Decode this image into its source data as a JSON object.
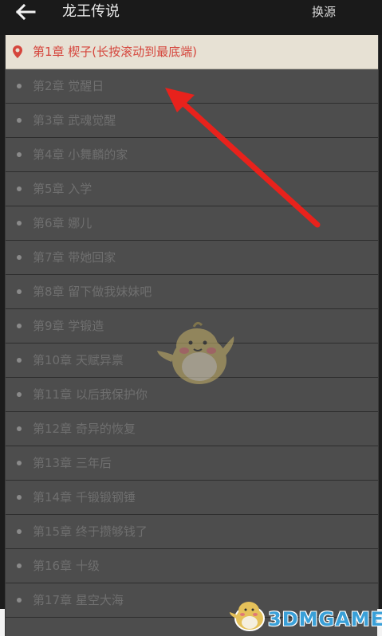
{
  "header": {
    "back_icon": "arrow-left-icon",
    "title": "龙王传说",
    "source_label": "换源"
  },
  "chapters": [
    {
      "label": "第1章 楔子(长按滚动到最底端)",
      "current": true
    },
    {
      "label": "第2章 觉醒日"
    },
    {
      "label": "第3章 武魂觉醒"
    },
    {
      "label": "第4章 小舞麟的家"
    },
    {
      "label": "第5章 入学"
    },
    {
      "label": "第6章 娜儿"
    },
    {
      "label": "第7章 带她回家"
    },
    {
      "label": "第8章 留下做我妹妹吧"
    },
    {
      "label": "第9章 学锻造"
    },
    {
      "label": "第10章 天赋异禀"
    },
    {
      "label": "第11章 以后我保护你"
    },
    {
      "label": "第12章 奇异的恢复"
    },
    {
      "label": "第13章 三年后"
    },
    {
      "label": "第14章 千锻锻钢锤"
    },
    {
      "label": "第15章 终于攒够钱了"
    },
    {
      "label": "第16章 十级"
    },
    {
      "label": "第17章 星空大海"
    }
  ],
  "colors": {
    "current_chapter": "#d5463d",
    "annotation_arrow": "#e8221c",
    "watermark": "#3aa0d8"
  },
  "annotation": {
    "icon": "red-arrow-pointer"
  },
  "watermark": {
    "text": "3DMGAME",
    "icon": "mascot-bird-icon"
  }
}
